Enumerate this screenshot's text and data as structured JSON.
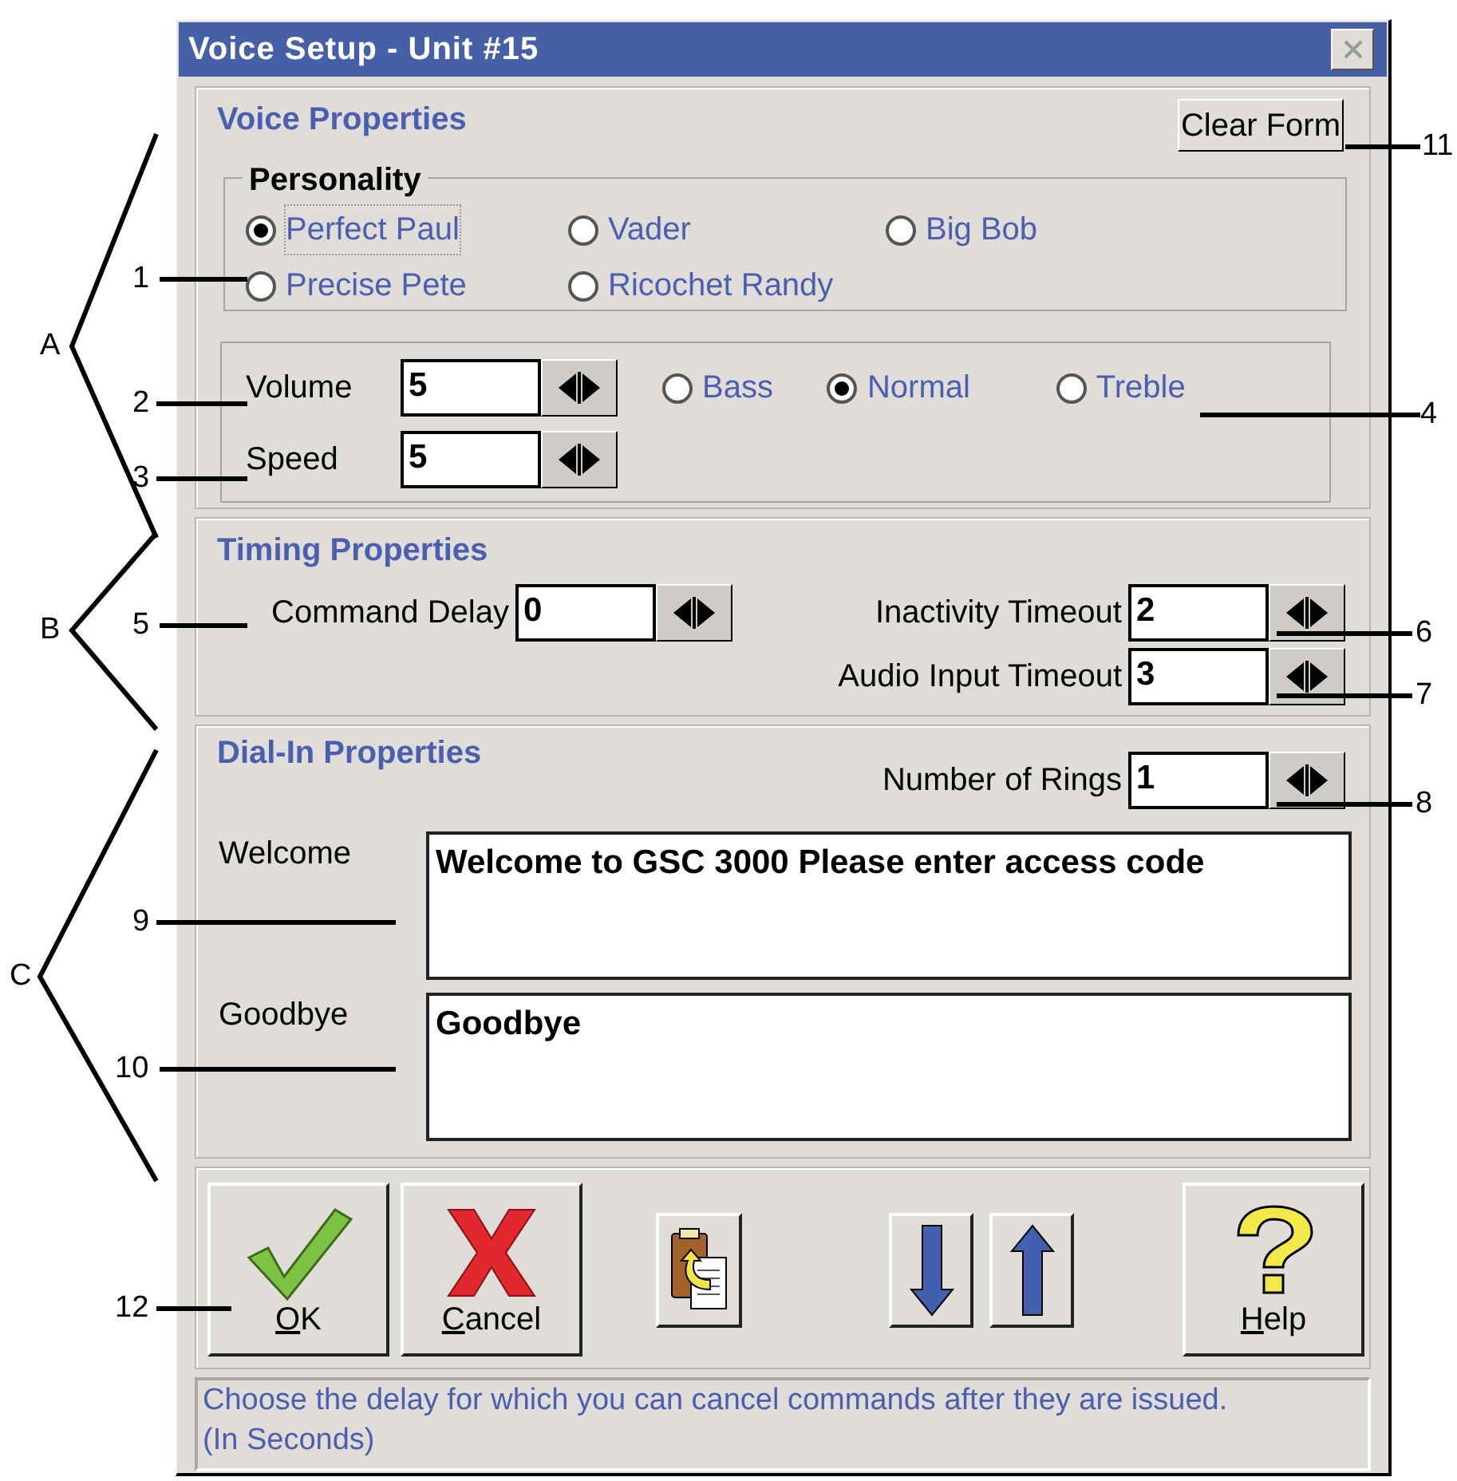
{
  "window": {
    "title": "Voice Setup - Unit #15"
  },
  "voice_properties": {
    "title": "Voice Properties",
    "clear_button": "Clear Form",
    "personality": {
      "title": "Personality",
      "options": [
        {
          "label": "Perfect Paul",
          "selected": true
        },
        {
          "label": "Vader",
          "selected": false
        },
        {
          "label": "Big Bob",
          "selected": false
        },
        {
          "label": "Precise Pete",
          "selected": false
        },
        {
          "label": "Ricochet Randy",
          "selected": false
        }
      ]
    },
    "spinners": [
      {
        "label": "Volume",
        "value": "5"
      },
      {
        "label": "Speed",
        "value": "5"
      }
    ],
    "tone": [
      {
        "label": "Bass",
        "selected": false
      },
      {
        "label": "Normal",
        "selected": true
      },
      {
        "label": "Treble",
        "selected": false
      }
    ]
  },
  "timing_properties": {
    "title": "Timing Properties",
    "command_delay": {
      "label": "Command Delay",
      "value": "0"
    },
    "timeouts": [
      {
        "label": "Inactivity Timeout",
        "value": "2"
      },
      {
        "label": "Audio Input Timeout",
        "value": "3"
      }
    ]
  },
  "dial_in_properties": {
    "title": "Dial-In Properties",
    "rings": {
      "label": "Number of Rings",
      "value": "1"
    },
    "messages": [
      {
        "label": "Welcome",
        "value": "Welcome to GSC 3000 Please enter access code"
      },
      {
        "label": "Goodbye",
        "value": "Goodbye"
      }
    ]
  },
  "toolbar": [
    {
      "kind": "ok",
      "label": "OK"
    },
    {
      "kind": "cancel",
      "label": "Cancel"
    },
    {
      "kind": "clipboard"
    },
    {
      "kind": "down"
    },
    {
      "kind": "up"
    },
    {
      "kind": "help",
      "label": "Help"
    }
  ],
  "status_bar": [
    "Choose the delay for which you can cancel commands after they are issued.",
    "(In Seconds)"
  ],
  "annotations": {
    "left_callouts": [
      "1",
      "2",
      "3",
      "5",
      "9",
      "10",
      "12"
    ],
    "right_callouts": [
      "11",
      "4",
      "6",
      "7",
      "8"
    ],
    "brackets": [
      "A",
      "B",
      "C"
    ]
  }
}
